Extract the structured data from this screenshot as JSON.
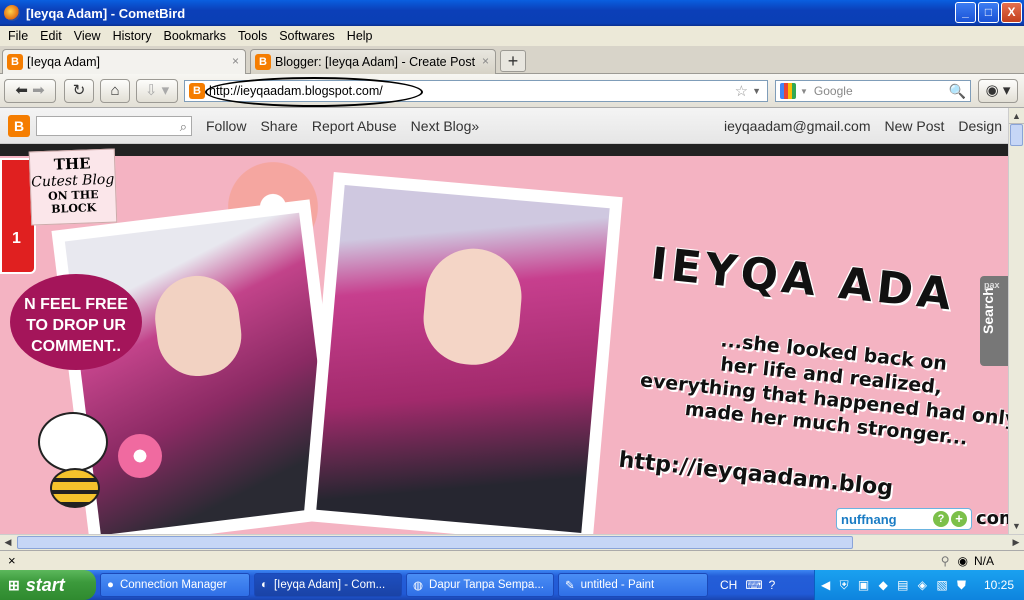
{
  "window": {
    "title": "[Ieyqa Adam] - CometBird",
    "min": "_",
    "max": "□",
    "close": "X"
  },
  "menu": [
    "File",
    "Edit",
    "View",
    "History",
    "Bookmarks",
    "Tools",
    "Softwares",
    "Help"
  ],
  "tabs": [
    {
      "label": "[Ieyqa Adam]"
    },
    {
      "label": "Blogger: [Ieyqa Adam] - Create Post"
    }
  ],
  "tab_close": "×",
  "newtab_label": "+",
  "nav": {
    "url": "http://ieyqaadam.blogspot.com/",
    "search_placeholder": "Google"
  },
  "blogger": {
    "logo": "B",
    "links": [
      "Follow",
      "Share",
      "Report Abuse",
      "Next Blog»"
    ],
    "email": "ieyqaadam@gmail.com",
    "new_post": "New Post",
    "design": "Design"
  },
  "banner": {
    "badge_lines": [
      "THE",
      "Cutest Blog",
      "ON THE BLOCK"
    ],
    "comment_lines": [
      "N FEEL FREE",
      "TO DROP UR",
      "COMMENT.."
    ],
    "name": "IEYQA ADA",
    "quote_lines": [
      "...she looked back on",
      "her life and realized,",
      "everything that happened had only",
      "made her much stronger..."
    ],
    "url_text": "http://ieyqaadam.blog",
    "url_tail": "com",
    "search_tab": "Search",
    "pax": "pax",
    "nuffnang": "nuffnang",
    "side_tab": "1"
  },
  "status": {
    "close_x": "×",
    "na": "N/A"
  },
  "taskbar": {
    "start": "start",
    "tasks": [
      {
        "label": "Connection Manager"
      },
      {
        "label": "[Ieyqa Adam] - Com..."
      },
      {
        "label": "Dapur Tanpa Sempa..."
      },
      {
        "label": "untitled - Paint"
      }
    ],
    "lang": "CH",
    "time": "10:25"
  }
}
